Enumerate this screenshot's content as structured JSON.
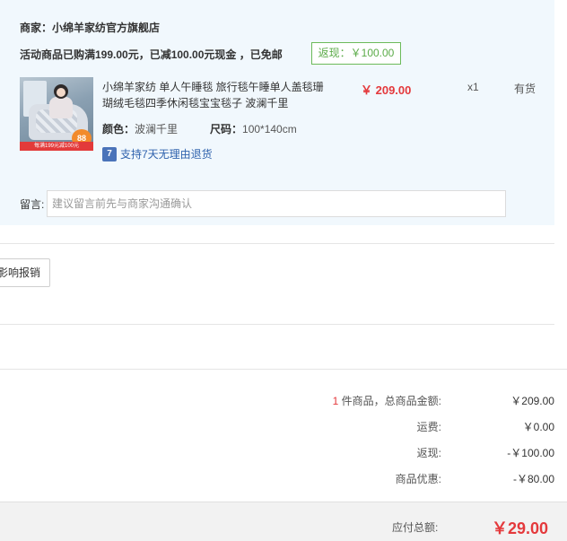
{
  "store": {
    "merchant": "商家：小绵羊家纺官方旗舰店",
    "promo": "活动商品已购满199.00元，已减100.00元现金 ，已免邮",
    "rebate_tag": "返现：￥100.00"
  },
  "product": {
    "thumbnail": {
      "badge": "88",
      "strip_text": "每满199元减100元"
    },
    "title": "小绵羊家纺 单人午睡毯 旅行毯午睡单人盖毯珊瑚绒毛毯四季休闲毯宝宝毯子 波澜千里",
    "price": "￥ 209.00",
    "quantity": "x1",
    "stock": "有货",
    "color_label": "颜色：",
    "color_value": "波澜千里",
    "size_label": "尺码：",
    "size_value": "100*140cm",
    "return_icon_text": "7",
    "return_text": "支持7天无理由退货"
  },
  "note": {
    "label": "留言:",
    "placeholder": "建议留言前先与商家沟通确认"
  },
  "report_button": "影响报销",
  "summary": {
    "item_count": "1",
    "item_count_suffix": " 件商品，总商品金额:",
    "item_total": "￥209.00",
    "shipping_label": "运费:",
    "shipping_value": "￥0.00",
    "rebate_label": "返现:",
    "rebate_value": "-￥100.00",
    "discount_label": "商品优惠:",
    "discount_value": "-￥80.00",
    "payable_label": "应付总额:",
    "payable_value": "￥29.00"
  },
  "colors": {
    "panel_bg": "#f1f8fd",
    "accent_red": "#e4393c",
    "rebate_green": "#5bab48",
    "link_blue": "#2f62ad"
  }
}
